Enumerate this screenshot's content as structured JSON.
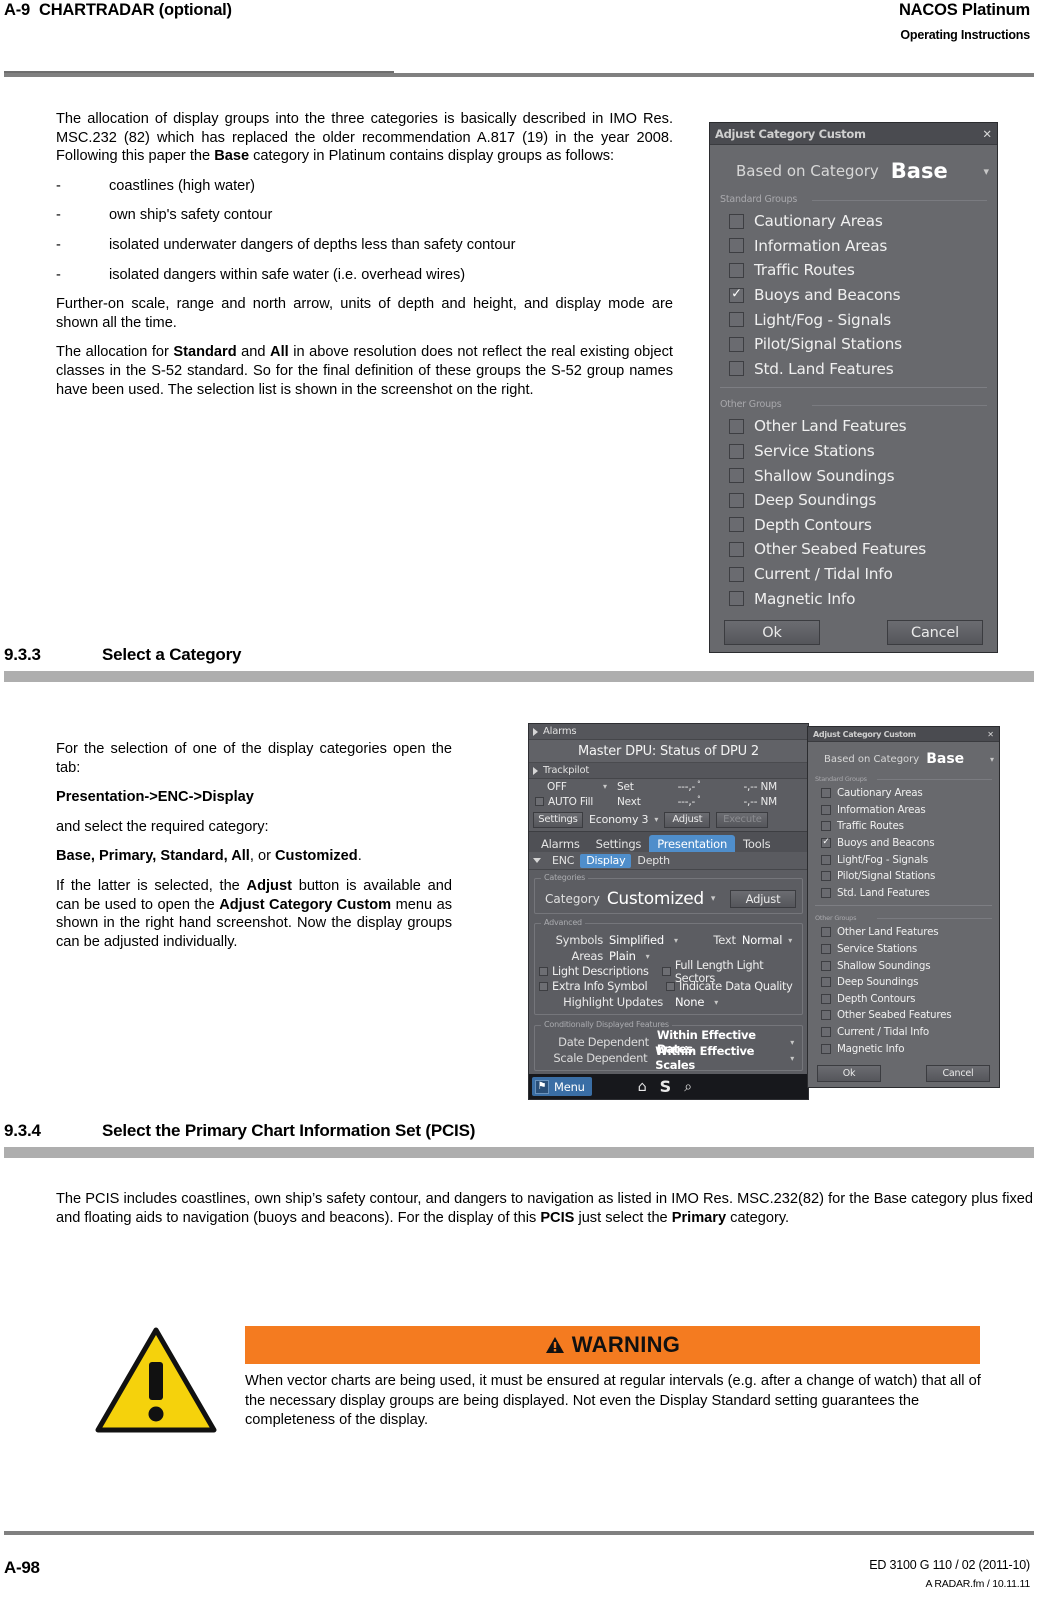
{
  "header": {
    "section_number": "A-9",
    "section_title": "CHARTRADAR (optional)",
    "brand": "NACOS Platinum",
    "subtitle": "Operating Instructions"
  },
  "footer": {
    "page": "A-98",
    "doc_id": "ED 3100 G 110 / 02 (2011-10)",
    "file_ref": "A RADAR.fm / 10.11.11"
  },
  "intro": {
    "p1_a": "The allocation of display groups into the three categories is basically described in IMO Res. MSC.232 (82) which has replaced the older recommendation A.817 (19) in the year 2008. Following this paper the ",
    "p1_b": "Base",
    "p1_c": " category in Platinum contains display groups as follows:",
    "bullets": [
      "coastlines (high water)",
      "own ship's safety contour",
      "isolated underwater dangers of depths less than safety contour",
      "isolated dangers within safe water (i.e. overhead wires)"
    ],
    "dash": "-",
    "p2": "Further-on scale, range and north arrow, units of depth and height, and display mode are shown all the time.",
    "p3_a": "The allocation for ",
    "p3_b": "Standard",
    "p3_c": " and ",
    "p3_d": "All",
    "p3_e": " in above resolution does not reflect the real existing object classes in the S-52 standard. So for the final definition of these groups the S-52 group names have been used. The selection list is shown in the screenshot on the right."
  },
  "section_933": {
    "number": "9.3.3",
    "title": "Select a Category",
    "p1": "For the selection of one of the display categories open the tab:",
    "path": "Presentation->ENC->Display",
    "p2": "and select the required category:",
    "categories_a": "Base, Primary, Standard, All",
    "categories_b": ", or ",
    "categories_c": "Customized",
    "categories_d": ".",
    "p3_a": "If the latter is selected, the ",
    "p3_b": "Adjust",
    "p3_c": " button is available and can be used to open the ",
    "p3_d": "Adjust Category Custom",
    "p3_e": " menu as shown in the right hand screenshot. Now the display groups can be adjusted individually."
  },
  "section_934": {
    "number": "9.3.4",
    "title": "Select the Primary Chart Information Set (PCIS)",
    "p1_a": "The PCIS includes coastlines, own ship’s safety contour, and dangers to navigation as listed in IMO Res. MSC.232(82) for the Base category plus fixed and floating aids to navigation (buoys and beacons). For the display of this ",
    "p1_b": "PCIS",
    "p1_c": " just select the ",
    "p1_d": "Primary",
    "p1_e": " category."
  },
  "warning": {
    "banner_label": "WARNING",
    "banner_color": "#F47B20",
    "body": "When vector charts are being used, it must be ensured at regular intervals (e.g. after a change of watch) that all of the necessary display groups are being displayed. Not even the Display Standard setting guarantees the completeness of the display."
  },
  "dialog_category_custom": {
    "title": "Adjust Category Custom",
    "close_label": "✕",
    "based_on_label": "Based on Category",
    "based_on_value": "Base",
    "caret": "▾",
    "standard_groups_legend": "Standard Groups",
    "other_groups_legend": "Other Groups",
    "standard_groups": [
      {
        "label": "Cautionary Areas",
        "checked": false
      },
      {
        "label": "Information Areas",
        "checked": false
      },
      {
        "label": "Traffic Routes",
        "checked": false
      },
      {
        "label": "Buoys and Beacons",
        "checked": true
      },
      {
        "label": "Light/Fog - Signals",
        "checked": false
      },
      {
        "label": "Pilot/Signal Stations",
        "checked": false
      },
      {
        "label": "Std. Land Features",
        "checked": false
      }
    ],
    "other_groups": [
      {
        "label": "Other Land Features",
        "checked": false
      },
      {
        "label": "Service Stations",
        "checked": false
      },
      {
        "label": "Shallow Soundings",
        "checked": false
      },
      {
        "label": "Deep Soundings",
        "checked": false
      },
      {
        "label": "Depth Contours",
        "checked": false
      },
      {
        "label": "Other Seabed Features",
        "checked": false
      },
      {
        "label": "Current / Tidal Info",
        "checked": false
      },
      {
        "label": "Magnetic Info",
        "checked": false
      }
    ],
    "ok_label": "Ok",
    "cancel_label": "Cancel"
  },
  "dpu_panel": {
    "alarms_header": "Alarms",
    "status_line": "Master DPU: Status of DPU 2",
    "trackpilot_header": "Trackpilot",
    "row_off": {
      "mode": "OFF",
      "caret": "▾",
      "set_label": "Set",
      "deg_value": "---,-",
      "deg_unit": "°",
      "nm_value": "-,--",
      "nm_unit": "NM"
    },
    "row_auto": {
      "mode": "AUTO Fill",
      "next_label": "Next",
      "deg_value": "---,-",
      "deg_unit": "°",
      "nm_value": "-,--",
      "nm_unit": "NM"
    },
    "settings_btn": "Settings",
    "economy_value": "Economy 3",
    "economy_caret": "▾",
    "adjust_btn": "Adjust",
    "execute_btn": "Execute",
    "tabs": [
      {
        "label": "Alarms",
        "active": false
      },
      {
        "label": "Settings",
        "active": false
      },
      {
        "label": "Presentation",
        "active": true
      },
      {
        "label": "Tools",
        "active": false
      }
    ],
    "subtabs": [
      {
        "label": "ENC",
        "active": false
      },
      {
        "label": "Display",
        "active": true
      },
      {
        "label": "Depth",
        "active": false
      }
    ],
    "categories_legend": "Categories",
    "category_label": "Category",
    "category_value": "Customized",
    "category_caret": "▾",
    "category_adjust_btn": "Adjust",
    "advanced_legend": "Advanced",
    "symbols_label": "Symbols",
    "symbols_value": "Simplified",
    "text_label": "Text",
    "text_value": "Normal",
    "areas_label": "Areas",
    "areas_value": "Plain",
    "checks": [
      {
        "label": "Light Descriptions",
        "checked": false
      },
      {
        "label": "Full Length Light Sectors",
        "checked": false
      },
      {
        "label": "Extra Info Symbol",
        "checked": false
      },
      {
        "label": "Indicate Data Quality",
        "checked": false
      }
    ],
    "highlight_label": "Highlight Updates",
    "highlight_value": "None",
    "conditional_legend": "Conditionally Displayed Features",
    "date_dependent_label": "Date Dependent",
    "date_dependent_value": "Within Effective Dates",
    "scale_dependent_label": "Scale Dependent",
    "scale_dependent_value": "Within Effective Scales",
    "menu_button": "Menu",
    "menu_icon_letter": "⚑",
    "menu_icons": [
      "home-icon",
      "s-icon",
      "search-icon"
    ]
  }
}
